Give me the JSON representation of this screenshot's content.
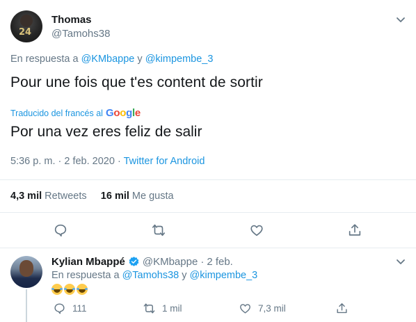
{
  "tweet": {
    "author_name": "Thomas",
    "author_handle": "@Tamohs38",
    "reply_prefix": "En respuesta a",
    "reply_users": [
      "@KMbappe",
      "@kimpembe_3"
    ],
    "reply_conjunction": "y",
    "text": "Pour une fois que t'es content de sortir",
    "translated_label": "Traducido del francés al",
    "translator": "Google",
    "translated_text": "Por una vez eres feliz de salir",
    "time": "5:36 p. m. · 2 feb. 2020",
    "source_sep": "·",
    "source": "Twitter for Android",
    "retweets_count": "4,3 mil",
    "retweets_label": "Retweets",
    "likes_count": "16 mil",
    "likes_label": "Me gusta"
  },
  "actions": [
    {
      "name": "reply-icon"
    },
    {
      "name": "retweet-icon"
    },
    {
      "name": "like-icon"
    },
    {
      "name": "share-icon"
    }
  ],
  "reply": {
    "author_name": "Kylian Mbappé",
    "author_handle": "@KMbappe",
    "date": "2 feb.",
    "date_sep": "·",
    "reply_prefix": "En respuesta a",
    "reply_users": [
      "@Tamohs38",
      "@kimpembe_3"
    ],
    "reply_conjunction": "y",
    "emoji_count": 3,
    "reply_count": "111",
    "retweet_count": "1 mil",
    "like_count": "7,3 mil"
  },
  "colors": {
    "link": "#1b95e0",
    "muted": "#657786",
    "divider": "#e6ecf0"
  }
}
